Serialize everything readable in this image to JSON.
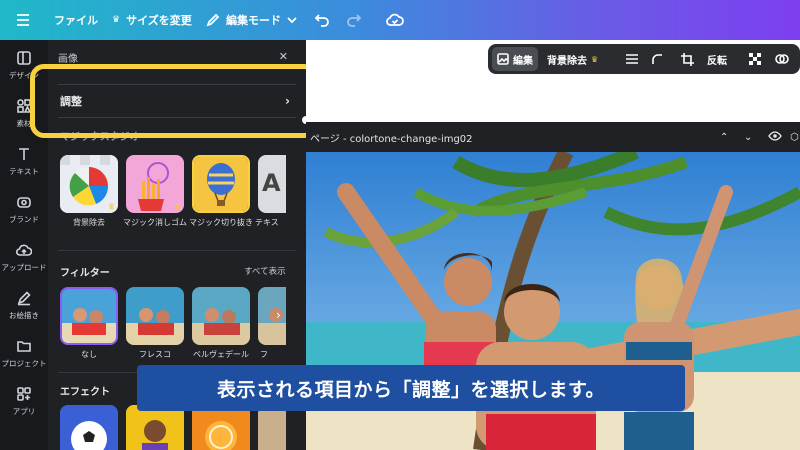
{
  "topbar": {
    "menu_icon": "hamburger-icon",
    "file_label": "ファイル",
    "resize_label": "サイズを変更",
    "edit_mode_label": "編集モード",
    "colors": {
      "gradient_start": "#1fb9c9",
      "gradient_end": "#7d3ff0"
    }
  },
  "rail": {
    "items": [
      {
        "label": "デザイン",
        "icon": "layout-icon"
      },
      {
        "label": "素材",
        "icon": "shapes-icon"
      },
      {
        "label": "テキスト",
        "icon": "text-icon"
      },
      {
        "label": "ブランド",
        "icon": "brand-icon"
      },
      {
        "label": "アップロード",
        "icon": "upload-cloud-icon"
      },
      {
        "label": "お絵描き",
        "icon": "pen-icon"
      },
      {
        "label": "プロジェクト",
        "icon": "folder-icon"
      },
      {
        "label": "アプリ",
        "icon": "apps-grid-icon"
      }
    ]
  },
  "panel": {
    "title": "画像",
    "adjust_label": "調整",
    "tools_title": "マジックスタジオ",
    "tools": [
      {
        "label": "背景除去"
      },
      {
        "label": "マジック消しゴム"
      },
      {
        "label": "マジック切り抜き"
      },
      {
        "label": "テキス"
      }
    ],
    "filters_title": "フィルター",
    "see_all": "すべて表示",
    "filters": [
      {
        "label": "なし"
      },
      {
        "label": "フレスコ"
      },
      {
        "label": "ベルヴェデール"
      },
      {
        "label": "フ"
      }
    ],
    "effects_title": "エフェクト",
    "highlight_color": "#f7d23e"
  },
  "canvas": {
    "toolbar": {
      "edit_label": "編集",
      "bg_remove_label": "背景除去",
      "flip_label": "反転"
    },
    "page_title": "ページ - colortone-change-img02"
  },
  "subtitle": {
    "text": "表示される項目から「調整」を選択します。",
    "color": "#1f4fa0"
  }
}
